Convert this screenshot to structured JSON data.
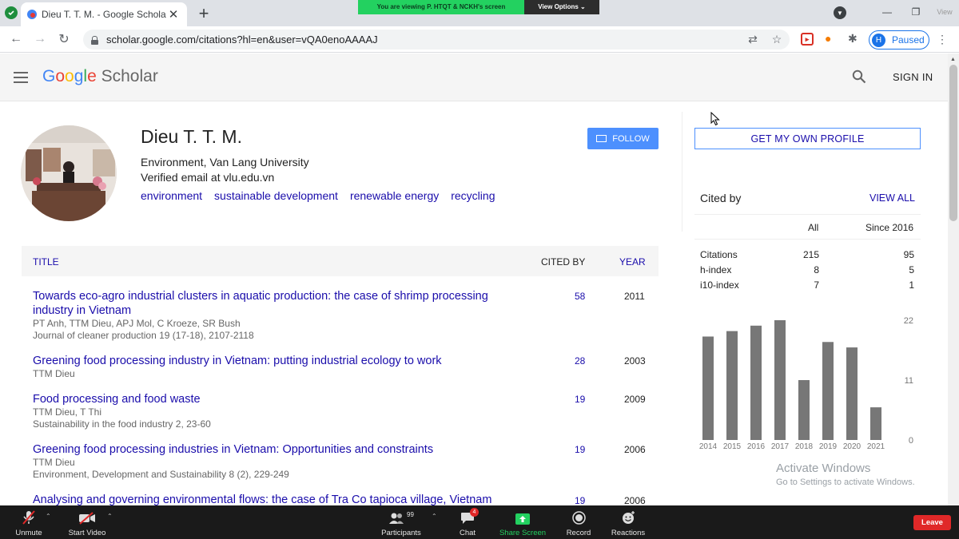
{
  "browser": {
    "tab_title": "Dieu T. T. M. - Google Scholar",
    "tab_close": "✕",
    "new_tab": "+",
    "url": "scholar.google.com/citations?hl=en&user=vQA0enoAAAAJ",
    "profile_initial": "H",
    "profile_status": "Paused",
    "restore_label": "View"
  },
  "zoom_banner": {
    "viewing": "You are viewing P. HTQT & NCKH's screen",
    "options": "View Options ⌄"
  },
  "header": {
    "logo_google": [
      "G",
      "o",
      "o",
      "g",
      "l",
      "e"
    ],
    "logo_scholar": "Scholar",
    "sign_in": "SIGN IN"
  },
  "profile": {
    "name": "Dieu T. T. M.",
    "affiliation": "Environment, Van Lang University",
    "email": "Verified email at vlu.edu.vn",
    "interests": [
      "environment",
      "sustainable development",
      "renewable energy",
      "recycling"
    ],
    "follow_label": "FOLLOW"
  },
  "table": {
    "col_title": "TITLE",
    "col_cited": "CITED BY",
    "col_year": "YEAR",
    "rows": [
      {
        "title": "Towards eco-agro industrial clusters in aquatic production: the case of shrimp processing industry in Vietnam",
        "authors": "PT Anh, TTM Dieu, APJ Mol, C Kroeze, SR Bush",
        "venue": "Journal of cleaner production 19 (17-18), 2107-2118",
        "cited": "58",
        "year": "2011"
      },
      {
        "title": "Greening food processing industry in Vietnam: putting industrial ecology to work",
        "authors": "TTM Dieu",
        "venue": "",
        "cited": "28",
        "year": "2003"
      },
      {
        "title": "Food processing and food waste",
        "authors": "TTM Dieu, T Thi",
        "venue": "Sustainability in the food industry 2, 23-60",
        "cited": "19",
        "year": "2009"
      },
      {
        "title": "Greening food processing industries in Vietnam: Opportunities and constraints",
        "authors": "TTM Dieu",
        "venue": "Environment, Development and Sustainability 8 (2), 229-249",
        "cited": "19",
        "year": "2006"
      },
      {
        "title": "Analysing and governing environmental flows: the case of Tra Co tapioca village, Vietnam",
        "authors": "",
        "venue": "",
        "cited": "19",
        "year": "2006"
      }
    ]
  },
  "sidebar": {
    "own_profile": "GET MY OWN PROFILE",
    "cited_by": "Cited by",
    "view_all": "VIEW ALL",
    "stats_header": {
      "all": "All",
      "since": "Since 2016"
    },
    "stats": [
      {
        "label": "Citations",
        "all": "215",
        "since": "95"
      },
      {
        "label": "h-index",
        "all": "8",
        "since": "5"
      },
      {
        "label": "i10-index",
        "all": "7",
        "since": "1"
      }
    ]
  },
  "chart_data": {
    "type": "bar",
    "categories": [
      "2014",
      "2015",
      "2016",
      "2017",
      "2018",
      "2019",
      "2020",
      "2021"
    ],
    "values": [
      19,
      20,
      21,
      22,
      11,
      18,
      17,
      6
    ],
    "yticks": [
      "22",
      "11",
      "0"
    ],
    "ylim": [
      0,
      22
    ],
    "bar_color": "#777777"
  },
  "watermark": {
    "line1": "Activate Windows",
    "line2": "Go to Settings to activate Windows."
  },
  "zoom_toolbar": {
    "unmute": "Unmute",
    "start_video": "Start Video",
    "participants": "Participants",
    "participants_count": "99",
    "chat": "Chat",
    "chat_badge": "4",
    "share_screen": "Share Screen",
    "record": "Record",
    "reactions": "Reactions",
    "leave": "Leave"
  }
}
